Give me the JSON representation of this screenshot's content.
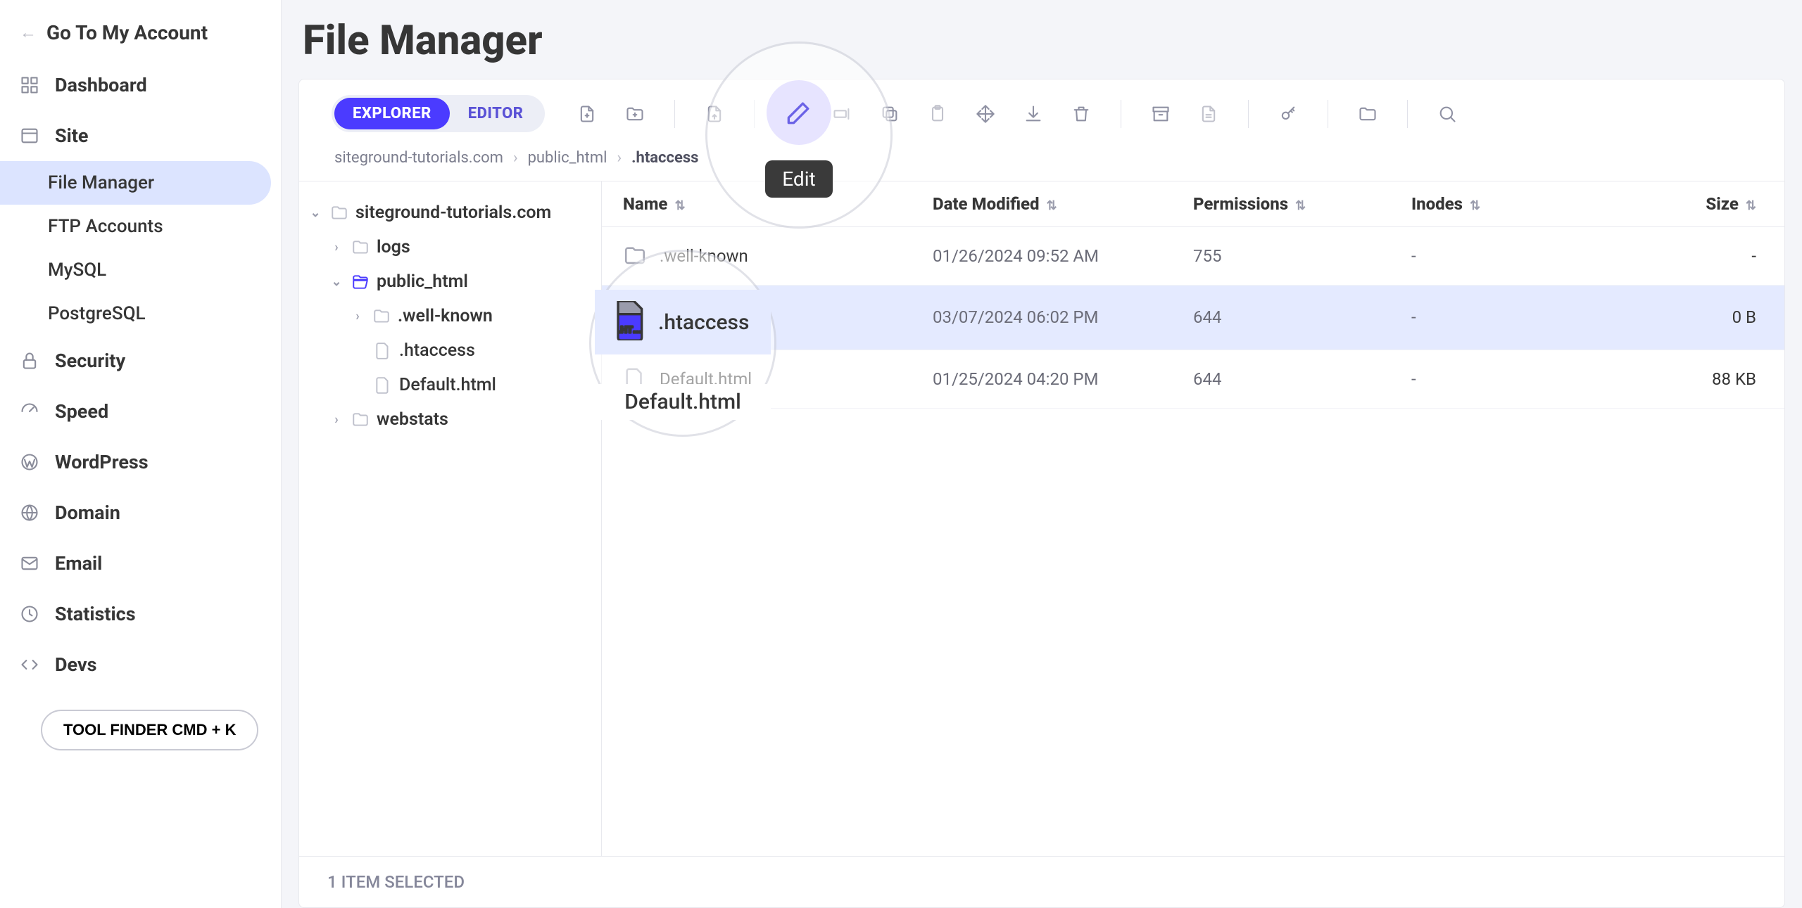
{
  "header": {
    "go_back": "Go To My Account"
  },
  "sidebar": {
    "items": [
      {
        "label": "Dashboard",
        "icon": "grid"
      },
      {
        "label": "Site",
        "icon": "site",
        "children": [
          {
            "label": "File Manager",
            "active": true
          },
          {
            "label": "FTP Accounts"
          },
          {
            "label": "MySQL"
          },
          {
            "label": "PostgreSQL"
          }
        ]
      },
      {
        "label": "Security",
        "icon": "lock"
      },
      {
        "label": "Speed",
        "icon": "gauge"
      },
      {
        "label": "WordPress",
        "icon": "wordpress"
      },
      {
        "label": "Domain",
        "icon": "globe"
      },
      {
        "label": "Email",
        "icon": "mail"
      },
      {
        "label": "Statistics",
        "icon": "clock"
      },
      {
        "label": "Devs",
        "icon": "code"
      }
    ],
    "tool_finder": "TOOL FINDER CMD + K"
  },
  "page": {
    "title": "File Manager",
    "tabs": {
      "explorer": "EXPLORER",
      "editor": "EDITOR"
    },
    "breadcrumb": [
      "siteground-tutorials.com",
      "public_html",
      ".htaccess"
    ]
  },
  "tree": {
    "root": "siteground-tutorials.com",
    "children": [
      {
        "name": "logs",
        "type": "folder"
      },
      {
        "name": "public_html",
        "type": "folder",
        "open": true,
        "children": [
          {
            "name": ".well-known",
            "type": "folder"
          },
          {
            "name": ".htaccess",
            "type": "file"
          },
          {
            "name": "Default.html",
            "type": "file"
          }
        ]
      },
      {
        "name": "webstats",
        "type": "folder"
      }
    ]
  },
  "table": {
    "columns": {
      "name": "Name",
      "date": "Date Modified",
      "perm": "Permissions",
      "inodes": "Inodes",
      "size": "Size"
    },
    "rows": [
      {
        "name": ".well-known",
        "date": "01/26/2024 09:52 AM",
        "perm": "755",
        "inodes": "-",
        "size": "-",
        "type": "folder"
      },
      {
        "name": ".htaccess",
        "date": "03/07/2024 06:02 PM",
        "perm": "644",
        "inodes": "-",
        "size": "0 B",
        "type": "ht",
        "selected": true
      },
      {
        "name": "Default.html",
        "date": "01/25/2024 04:20 PM",
        "perm": "644",
        "inodes": "-",
        "size": "88 KB",
        "type": "file"
      }
    ]
  },
  "status": {
    "text": "1 ITEM SELECTED"
  },
  "callouts": {
    "edit_label": "Edit",
    "file_name": ".htaccess",
    "peek_name": "Default.html"
  }
}
